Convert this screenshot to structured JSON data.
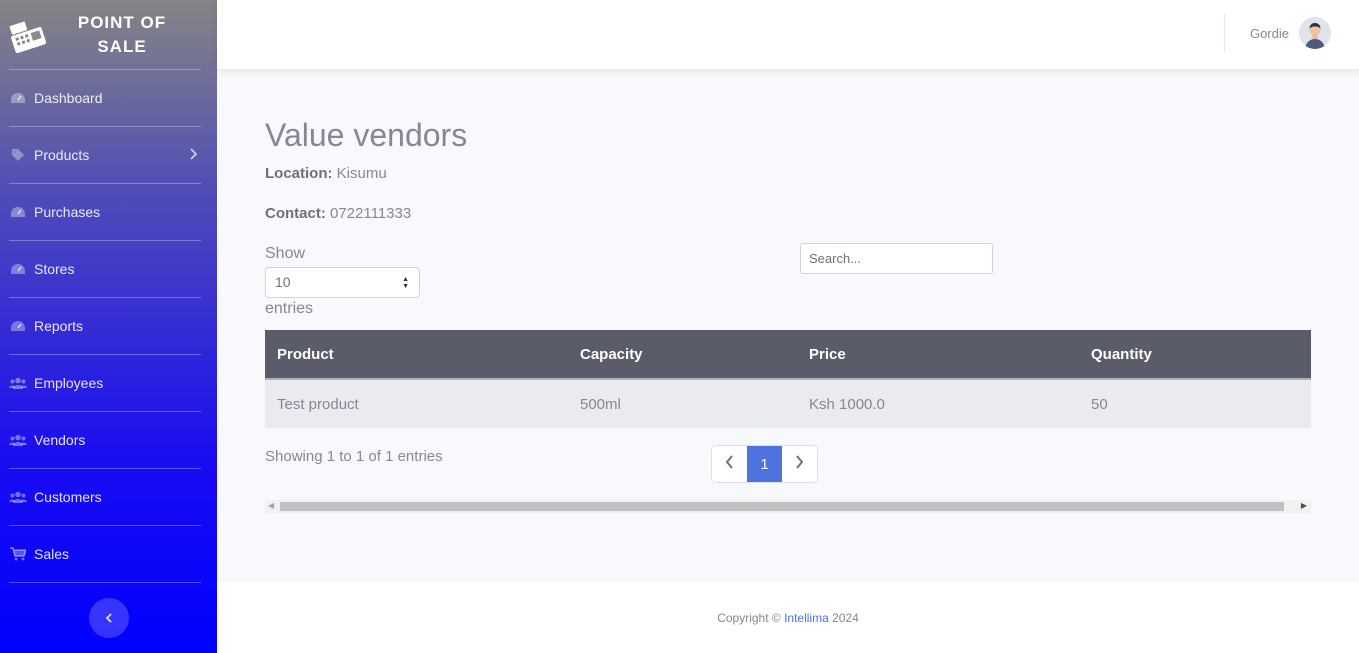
{
  "brand": {
    "line1": "POINT OF",
    "line2": "SALE",
    "icon": "cash-register-icon"
  },
  "sidebar": {
    "items": [
      {
        "label": "Dashboard",
        "icon": "gauge-icon"
      },
      {
        "label": "Products",
        "icon": "tag-icon",
        "has_submenu": true
      },
      {
        "label": "Purchases",
        "icon": "gauge-icon"
      },
      {
        "label": "Stores",
        "icon": "gauge-icon"
      },
      {
        "label": "Reports",
        "icon": "gauge-icon"
      },
      {
        "label": "Employees",
        "icon": "users-icon"
      },
      {
        "label": "Vendors",
        "icon": "users-icon"
      },
      {
        "label": "Customers",
        "icon": "users-icon"
      },
      {
        "label": "Sales",
        "icon": "cart-icon"
      }
    ],
    "toggle_icon": "chevron-left-icon"
  },
  "topbar": {
    "username": "Gordie"
  },
  "page": {
    "title": "Value vendors",
    "location_label": "Location:",
    "location_value": "Kisumu",
    "contact_label": "Contact:",
    "contact_value": "0722111333"
  },
  "table_controls": {
    "show_label": "Show",
    "page_size": "10",
    "entries_label": "entries",
    "search_placeholder": "Search..."
  },
  "table": {
    "columns": [
      "Product",
      "Capacity",
      "Price",
      "Quantity"
    ],
    "rows": [
      [
        "Test product",
        "500ml",
        "Ksh 1000.0",
        "50"
      ]
    ]
  },
  "pagination": {
    "info": "Showing 1 to 1 of 1 entries",
    "current_page": "1"
  },
  "footer": {
    "prefix": "Copyright ©",
    "company": "Intellima",
    "year": "2024"
  },
  "colors": {
    "accent": "#4e73df",
    "table_header": "#5a5c69",
    "sidebar_top": "#858585",
    "sidebar_bottom": "#0000ff"
  }
}
